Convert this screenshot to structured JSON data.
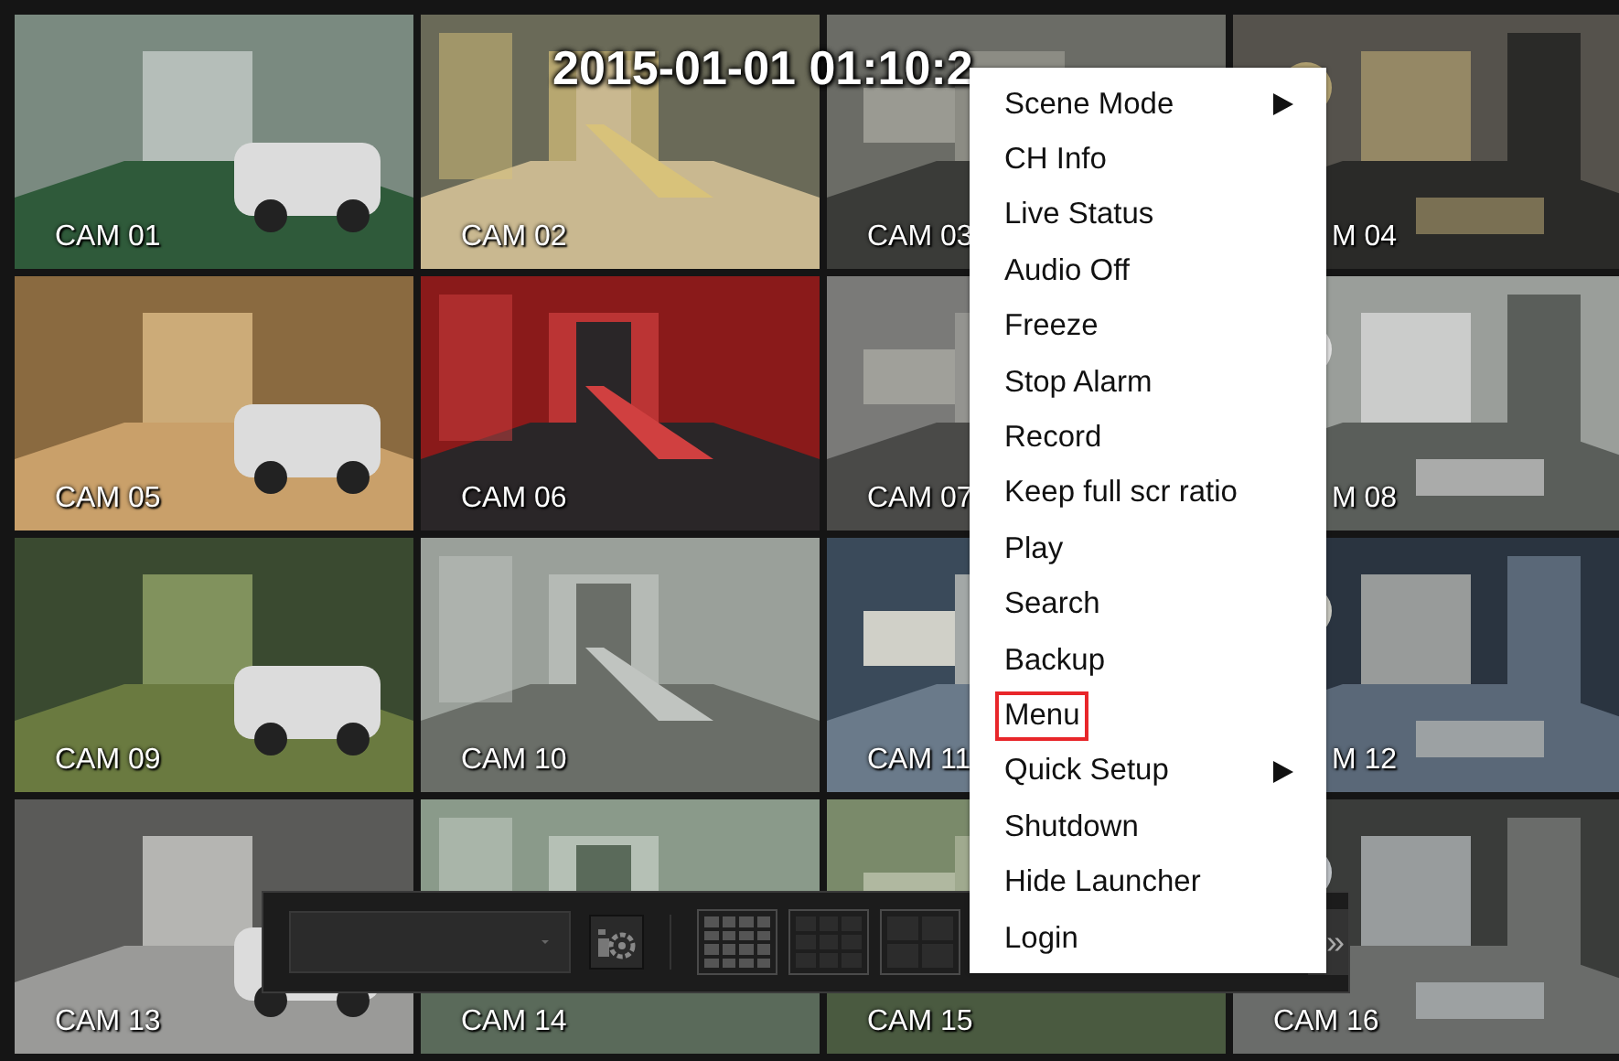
{
  "timestamp": "2015-01-01 01:10:2",
  "cameras": [
    {
      "label": "CAM 01"
    },
    {
      "label": "CAM 02"
    },
    {
      "label": "CAM 03"
    },
    {
      "label": "M 04"
    },
    {
      "label": "CAM 05"
    },
    {
      "label": "CAM 06"
    },
    {
      "label": "CAM 07"
    },
    {
      "label": "M 08"
    },
    {
      "label": "CAM 09"
    },
    {
      "label": "CAM 10"
    },
    {
      "label": "CAM 11"
    },
    {
      "label": "M 12"
    },
    {
      "label": "CAM 13"
    },
    {
      "label": "CAM 14"
    },
    {
      "label": "CAM 15"
    },
    {
      "label": "CAM 16"
    }
  ],
  "menu": {
    "items": [
      {
        "label": "Scene Mode",
        "submenu": true,
        "selected": false
      },
      {
        "label": "CH Info",
        "submenu": false,
        "selected": false
      },
      {
        "label": "Live Status",
        "submenu": false,
        "selected": false
      },
      {
        "label": "Audio Off",
        "submenu": false,
        "selected": false
      },
      {
        "label": "Freeze",
        "submenu": false,
        "selected": false
      },
      {
        "label": "Stop Alarm",
        "submenu": false,
        "selected": false
      },
      {
        "label": "Record",
        "submenu": false,
        "selected": false
      },
      {
        "label": "Keep full scr ratio",
        "submenu": false,
        "selected": false
      },
      {
        "label": "Play",
        "submenu": false,
        "selected": false
      },
      {
        "label": "Search",
        "submenu": false,
        "selected": false
      },
      {
        "label": "Backup",
        "submenu": false,
        "selected": false
      },
      {
        "label": "Menu",
        "submenu": false,
        "selected": true
      },
      {
        "label": "Quick Setup",
        "submenu": true,
        "selected": false
      },
      {
        "label": "Shutdown",
        "submenu": false,
        "selected": false
      },
      {
        "label": "Hide Launcher",
        "submenu": false,
        "selected": false
      },
      {
        "label": "Login",
        "submenu": false,
        "selected": false
      }
    ]
  },
  "launcher": {
    "layouts": [
      {
        "kind": "split16",
        "selected": true
      },
      {
        "kind": "split9",
        "selected": false
      },
      {
        "kind": "split4",
        "selected": false
      }
    ],
    "more": "»"
  }
}
